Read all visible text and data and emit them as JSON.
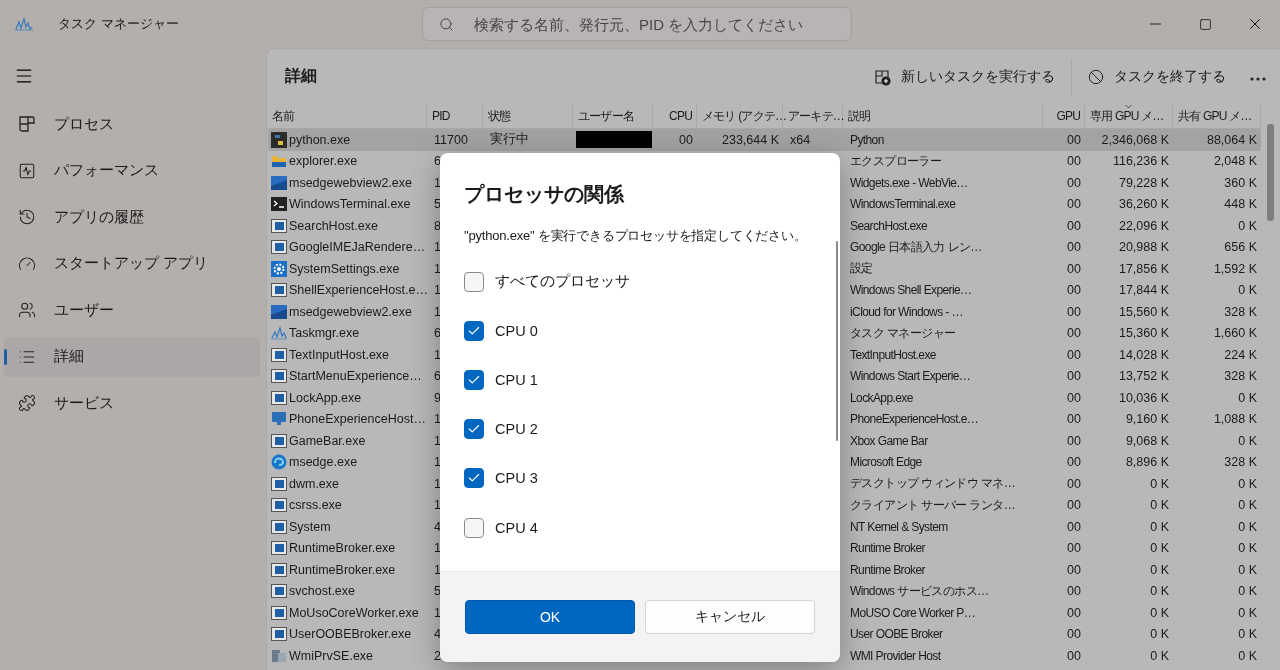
{
  "window": {
    "title": "タスク マネージャー"
  },
  "search": {
    "placeholder": "検索する名前、発行元、PID を入力してください"
  },
  "nav": {
    "items": [
      {
        "label": "プロセス",
        "kind": "processes",
        "selected": false
      },
      {
        "label": "パフォーマンス",
        "kind": "performance",
        "selected": false
      },
      {
        "label": "アプリの履歴",
        "kind": "history",
        "selected": false
      },
      {
        "label": "スタートアップ アプリ",
        "kind": "startup",
        "selected": false
      },
      {
        "label": "ユーザー",
        "kind": "users",
        "selected": false
      },
      {
        "label": "詳細",
        "kind": "details",
        "selected": true
      },
      {
        "label": "サービス",
        "kind": "services",
        "selected": false
      }
    ]
  },
  "page": {
    "title": "詳細",
    "actions": [
      {
        "label": "新しいタスクを実行する",
        "kind": "new"
      },
      {
        "label": "タスクを終了する",
        "kind": "end"
      }
    ]
  },
  "table": {
    "columns": [
      {
        "label": "名前",
        "sorted": false
      },
      {
        "label": "PID",
        "sorted": false
      },
      {
        "label": "状態",
        "sorted": false
      },
      {
        "label": "ユーザー名",
        "sorted": false
      },
      {
        "label": "CPU",
        "sorted": false
      },
      {
        "label": "メモリ (アクテ…",
        "sorted": false
      },
      {
        "label": "アーキテ…",
        "sorted": false
      },
      {
        "label": "説明",
        "sorted": false
      },
      {
        "label": "GPU",
        "sorted": false
      },
      {
        "label": "専用 GPU メ…",
        "sorted": true
      },
      {
        "label": "共有 GPU メ…",
        "sorted": false
      }
    ],
    "rows": [
      {
        "kind": "python",
        "selected": true,
        "cells": [
          "python.exe",
          "11700",
          "実行中",
          null,
          "00",
          "233,644 K",
          "x64",
          "Python",
          "00",
          "2,346,068 K",
          "88,064 K"
        ],
        "user_redacted": true
      },
      {
        "kind": "folder",
        "selected": false,
        "cells": [
          "explorer.exe",
          "6",
          null,
          null,
          null,
          null,
          null,
          "エクスプローラー",
          "00",
          "116,236 K",
          "2,048 K"
        ]
      },
      {
        "kind": "webview",
        "selected": false,
        "cells": [
          "msedgewebview2.exe",
          "1",
          null,
          null,
          null,
          null,
          null,
          "Widgets.exe - WebVie…",
          "00",
          "79,228 K",
          "360 K"
        ]
      },
      {
        "kind": "terminal",
        "selected": false,
        "cells": [
          "WindowsTerminal.exe",
          "5",
          null,
          null,
          null,
          null,
          null,
          "WindowsTerminal.exe",
          "00",
          "36,260 K",
          "448 K"
        ]
      },
      {
        "kind": "app",
        "selected": false,
        "cells": [
          "SearchHost.exe",
          "8",
          null,
          null,
          null,
          null,
          null,
          "SearchHost.exe",
          "00",
          "22,096 K",
          "0 K"
        ]
      },
      {
        "kind": "app",
        "selected": false,
        "cells": [
          "GoogleIMEJaRendere…",
          "1",
          null,
          null,
          null,
          null,
          null,
          "Google 日本語入力 レン…",
          "00",
          "20,988 K",
          "656 K"
        ]
      },
      {
        "kind": "settings",
        "selected": false,
        "cells": [
          "SystemSettings.exe",
          "1",
          null,
          null,
          null,
          null,
          null,
          "設定",
          "00",
          "17,856 K",
          "1,592 K"
        ]
      },
      {
        "kind": "app",
        "selected": false,
        "cells": [
          "ShellExperienceHost.e…",
          "1",
          null,
          null,
          null,
          null,
          null,
          "Windows Shell Experie…",
          "00",
          "17,844 K",
          "0 K"
        ]
      },
      {
        "kind": "webview",
        "selected": false,
        "cells": [
          "msedgewebview2.exe",
          "1",
          null,
          null,
          null,
          null,
          null,
          "iCloud for Windows - …",
          "00",
          "15,560 K",
          "328 K"
        ]
      },
      {
        "kind": "taskmgr",
        "selected": false,
        "cells": [
          "Taskmgr.exe",
          "6",
          null,
          null,
          null,
          null,
          null,
          "タスク マネージャー",
          "00",
          "15,360 K",
          "1,660 K"
        ]
      },
      {
        "kind": "app",
        "selected": false,
        "cells": [
          "TextInputHost.exe",
          "1",
          null,
          null,
          null,
          null,
          null,
          "TextInputHost.exe",
          "00",
          "14,028 K",
          "224 K"
        ]
      },
      {
        "kind": "app",
        "selected": false,
        "cells": [
          "StartMenuExperience…",
          "6",
          null,
          null,
          null,
          null,
          null,
          "Windows Start Experie…",
          "00",
          "13,752 K",
          "328 K"
        ]
      },
      {
        "kind": "app",
        "selected": false,
        "cells": [
          "LockApp.exe",
          "9",
          null,
          null,
          null,
          null,
          null,
          "LockApp.exe",
          "00",
          "10,036 K",
          "0 K"
        ]
      },
      {
        "kind": "phone",
        "selected": false,
        "cells": [
          "PhoneExperienceHost…",
          "1",
          null,
          null,
          null,
          null,
          null,
          "PhoneExperienceHost.e…",
          "00",
          "9,160 K",
          "1,088 K"
        ]
      },
      {
        "kind": "app",
        "selected": false,
        "cells": [
          "GameBar.exe",
          "1",
          null,
          null,
          null,
          null,
          null,
          "Xbox Game Bar",
          "00",
          "9,068 K",
          "0 K"
        ]
      },
      {
        "kind": "edge",
        "selected": false,
        "cells": [
          "msedge.exe",
          "1",
          null,
          null,
          null,
          null,
          null,
          "Microsoft Edge",
          "00",
          "8,896 K",
          "328 K"
        ]
      },
      {
        "kind": "app",
        "selected": false,
        "cells": [
          "dwm.exe",
          "1",
          null,
          null,
          null,
          null,
          null,
          "デスクトップ ウィンドウ マネ…",
          "00",
          "0 K",
          "0 K"
        ]
      },
      {
        "kind": "app",
        "selected": false,
        "cells": [
          "csrss.exe",
          "1",
          null,
          null,
          null,
          null,
          null,
          "クライアント サーバー ランタ…",
          "00",
          "0 K",
          "0 K"
        ]
      },
      {
        "kind": "app",
        "selected": false,
        "cells": [
          "System",
          "4",
          null,
          null,
          null,
          null,
          null,
          "NT Kernel & System",
          "00",
          "0 K",
          "0 K"
        ]
      },
      {
        "kind": "app",
        "selected": false,
        "cells": [
          "RuntimeBroker.exe",
          "1",
          null,
          null,
          null,
          null,
          null,
          "Runtime Broker",
          "00",
          "0 K",
          "0 K"
        ]
      },
      {
        "kind": "app",
        "selected": false,
        "cells": [
          "RuntimeBroker.exe",
          "1",
          null,
          null,
          null,
          null,
          null,
          "Runtime Broker",
          "00",
          "0 K",
          "0 K"
        ]
      },
      {
        "kind": "app",
        "selected": false,
        "cells": [
          "svchost.exe",
          "5",
          null,
          null,
          null,
          null,
          null,
          "Windows サービスのホス…",
          "00",
          "0 K",
          "0 K"
        ]
      },
      {
        "kind": "app",
        "selected": false,
        "cells": [
          "MoUsoCoreWorker.exe",
          "1",
          null,
          null,
          null,
          null,
          null,
          "MoUSO Core Worker P…",
          "00",
          "0 K",
          "0 K"
        ]
      },
      {
        "kind": "app",
        "selected": false,
        "cells": [
          "UserOOBEBroker.exe",
          "4",
          null,
          null,
          null,
          null,
          null,
          "User OOBE Broker",
          "00",
          "0 K",
          "0 K"
        ]
      },
      {
        "kind": "wmi",
        "selected": false,
        "cells": [
          "WmiPrvSE.exe",
          "2",
          null,
          null,
          null,
          null,
          null,
          "WMI Provider Host",
          "00",
          "0 K",
          "0 K"
        ]
      }
    ]
  },
  "dialog": {
    "title": "プロセッサの関係",
    "description": "\"python.exe\" を実行できるプロセッサを指定してください。",
    "options": [
      {
        "label": "すべてのプロセッサ",
        "checked": false
      },
      {
        "label": "CPU 0",
        "checked": true
      },
      {
        "label": "CPU 1",
        "checked": true
      },
      {
        "label": "CPU 2",
        "checked": true
      },
      {
        "label": "CPU 3",
        "checked": true
      },
      {
        "label": "CPU 4",
        "checked": false
      }
    ],
    "buttons": [
      {
        "label": "OK",
        "kind": "primary"
      },
      {
        "label": "キャンセル",
        "kind": "secondary"
      }
    ]
  }
}
